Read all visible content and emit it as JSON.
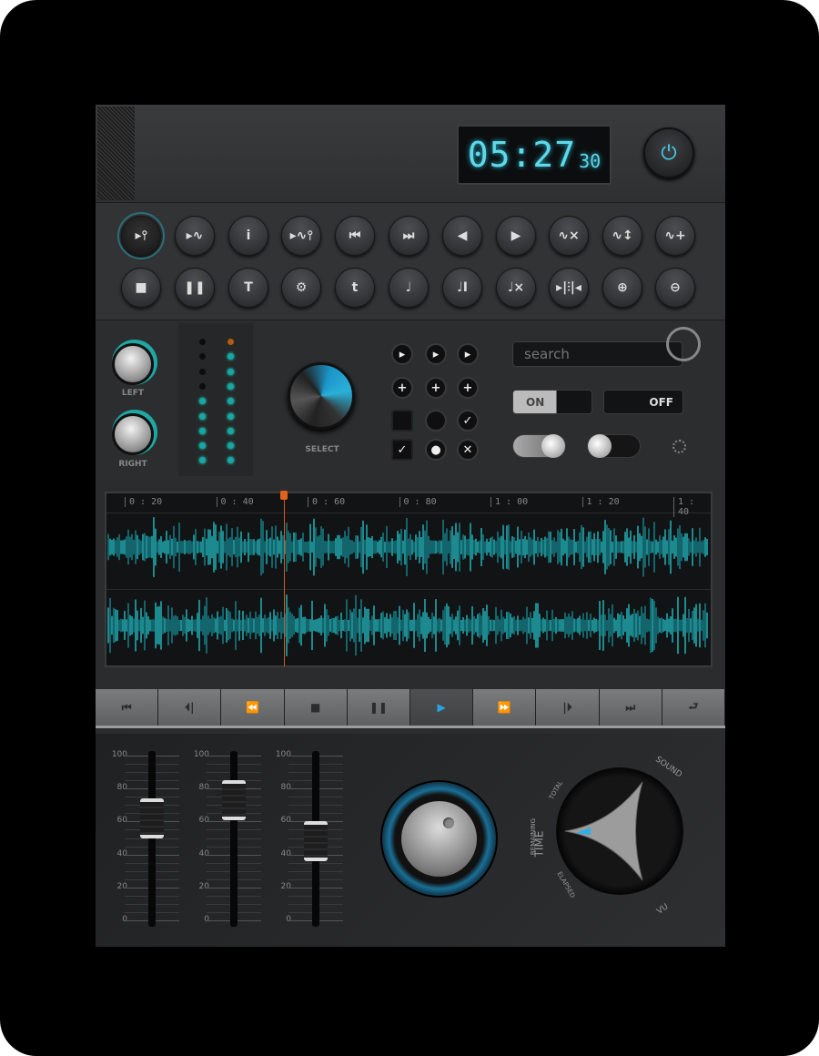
{
  "clock": {
    "time": "05:27",
    "seconds": "30"
  },
  "colors": {
    "accent": "#3fd0ea",
    "playhead": "#e2621d",
    "led_on": "#19a6a8"
  },
  "toolbar": {
    "row1": [
      {
        "icon": "marker-insert-icon",
        "glyph": "▸⫯"
      },
      {
        "icon": "marker-wave-icon",
        "glyph": "▸∿"
      },
      {
        "icon": "info-icon",
        "glyph": "i"
      },
      {
        "icon": "marker-wave-pin-icon",
        "glyph": "▸∿⫯"
      },
      {
        "icon": "skip-start-icon",
        "glyph": "⏮"
      },
      {
        "icon": "skip-end-icon",
        "glyph": "⏭"
      },
      {
        "icon": "arrow-left-icon",
        "glyph": "◀"
      },
      {
        "icon": "arrow-right-icon",
        "glyph": "▶"
      },
      {
        "icon": "wave-remove-icon",
        "glyph": "∿×"
      },
      {
        "icon": "wave-resize-icon",
        "glyph": "∿↕"
      },
      {
        "icon": "wave-add-icon",
        "glyph": "∿+"
      }
    ],
    "row2": [
      {
        "icon": "stop-icon",
        "glyph": "■"
      },
      {
        "icon": "pause-icon",
        "glyph": "❚❚"
      },
      {
        "icon": "text-icon",
        "glyph": "T"
      },
      {
        "icon": "gear-icon",
        "glyph": "⚙"
      },
      {
        "icon": "tempo-icon",
        "glyph": "t"
      },
      {
        "icon": "note-icon",
        "glyph": "♩"
      },
      {
        "icon": "note-text-icon",
        "glyph": "♩I"
      },
      {
        "icon": "note-remove-icon",
        "glyph": "♩×"
      },
      {
        "icon": "split-icon",
        "glyph": "▸|⫶|◂"
      },
      {
        "icon": "zoom-in-icon",
        "glyph": "⊕"
      },
      {
        "icon": "zoom-out-icon",
        "glyph": "⊖"
      }
    ]
  },
  "knobs": {
    "left_label": "LEFT",
    "right_label": "RIGHT",
    "select_label": "SELECT"
  },
  "leds": {
    "left": [
      0,
      0,
      0,
      0,
      1,
      1,
      1,
      1,
      1
    ],
    "right": [
      2,
      1,
      1,
      1,
      1,
      1,
      1,
      1,
      1
    ]
  },
  "grid": [
    [
      "▸",
      "▸",
      "▸"
    ],
    [
      "+",
      "+",
      "+"
    ],
    [
      "",
      "",
      "✓"
    ],
    [
      "✓",
      "●",
      "✕"
    ]
  ],
  "search": {
    "placeholder": "search"
  },
  "toggles": {
    "on_label": "ON",
    "off_label": "OFF",
    "on_state": true,
    "off_state": false,
    "switch1_on": true,
    "switch2_on": false
  },
  "timeline": {
    "ticks": [
      "0 : 20",
      "0 : 40",
      "0 : 60",
      "0 : 80",
      "1 : 00",
      "1 : 20",
      "1 : 40"
    ]
  },
  "transport": [
    {
      "icon": "rewind-start-icon",
      "glyph": "⏮"
    },
    {
      "icon": "previous-icon",
      "glyph": "⏴|"
    },
    {
      "icon": "rewind-icon",
      "glyph": "⏪"
    },
    {
      "icon": "stop-icon",
      "glyph": "■"
    },
    {
      "icon": "pause-icon",
      "glyph": "❚❚"
    },
    {
      "icon": "play-icon",
      "glyph": "▶",
      "active": true
    },
    {
      "icon": "fast-forward-icon",
      "glyph": "⏩"
    },
    {
      "icon": "next-icon",
      "glyph": "|⏵"
    },
    {
      "icon": "forward-end-icon",
      "glyph": "⏭"
    },
    {
      "icon": "repeat-icon",
      "glyph": "⮐"
    }
  ],
  "faders": {
    "scale": [
      "100",
      "80",
      "60",
      "40",
      "20",
      "0"
    ],
    "values": [
      62,
      73,
      48
    ]
  },
  "mode_dial": {
    "time": "TIME",
    "total": "TOTAL",
    "remaining": "REMAINING",
    "elapsed": "ELAPSED",
    "sound": "SOUND",
    "vu": "VU"
  }
}
